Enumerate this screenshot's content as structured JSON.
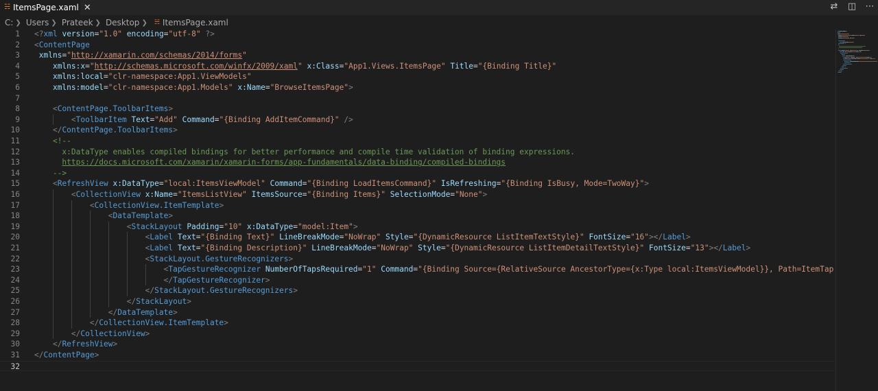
{
  "tab": {
    "label": "ItemsPage.xaml",
    "close_label": "✕"
  },
  "icons": {
    "xml": "rss-xml-icon",
    "compare": "compare-changes-icon",
    "split": "split-editor-icon",
    "more": "more-actions-icon"
  },
  "breadcrumb": [
    "C:",
    "Users",
    "Prateek",
    "Desktop",
    "ItemsPage.xaml"
  ],
  "colors": {
    "tag": "#569cd6",
    "attr": "#9cdcfe",
    "string": "#ce9178",
    "comment": "#6a9955",
    "punct": "#808080"
  },
  "lines": [
    [
      [
        "t-pi",
        "<?"
      ],
      [
        "t-tag",
        "xml"
      ],
      [
        "t-eq",
        " "
      ],
      [
        "t-attr",
        "version"
      ],
      [
        "t-eq",
        "="
      ],
      [
        "t-str",
        "\"1.0\""
      ],
      [
        "t-eq",
        " "
      ],
      [
        "t-attr",
        "encoding"
      ],
      [
        "t-eq",
        "="
      ],
      [
        "t-str",
        "\"utf-8\""
      ],
      [
        "t-eq",
        " "
      ],
      [
        "t-pi",
        "?>"
      ]
    ],
    [
      [
        "t-punct",
        "<"
      ],
      [
        "t-tag",
        "ContentPage"
      ]
    ],
    [
      [
        "t-eq",
        " "
      ],
      [
        "t-attr",
        "xmlns"
      ],
      [
        "t-eq",
        "="
      ],
      [
        "t-str",
        "\""
      ],
      [
        "t-url",
        "http://xamarin.com/schemas/2014/forms"
      ],
      [
        "t-str",
        "\""
      ]
    ],
    [
      [
        "t-eq",
        "    "
      ],
      [
        "t-attr",
        "xmlns:x"
      ],
      [
        "t-eq",
        "="
      ],
      [
        "t-str",
        "\""
      ],
      [
        "t-url",
        "http://schemas.microsoft.com/winfx/2009/xaml"
      ],
      [
        "t-str",
        "\""
      ],
      [
        "t-eq",
        " "
      ],
      [
        "t-attr",
        "x:Class"
      ],
      [
        "t-eq",
        "="
      ],
      [
        "t-str",
        "\"App1.Views.ItemsPage\""
      ],
      [
        "t-eq",
        " "
      ],
      [
        "t-attr",
        "Title"
      ],
      [
        "t-eq",
        "="
      ],
      [
        "t-str",
        "\"{Binding Title}\""
      ]
    ],
    [
      [
        "t-eq",
        "    "
      ],
      [
        "t-attr",
        "xmlns:local"
      ],
      [
        "t-eq",
        "="
      ],
      [
        "t-str",
        "\"clr-namespace:App1.ViewModels\""
      ]
    ],
    [
      [
        "t-eq",
        "    "
      ],
      [
        "t-attr",
        "xmlns:model"
      ],
      [
        "t-eq",
        "="
      ],
      [
        "t-str",
        "\"clr-namespace:App1.Models\""
      ],
      [
        "t-eq",
        " "
      ],
      [
        "t-attr",
        "x:Name"
      ],
      [
        "t-eq",
        "="
      ],
      [
        "t-str",
        "\"BrowseItemsPage\""
      ],
      [
        "t-punct",
        ">"
      ]
    ],
    [],
    [
      [
        "t-eq",
        "    "
      ],
      [
        "t-punct",
        "<"
      ],
      [
        "t-tag",
        "ContentPage.ToolbarItems"
      ],
      [
        "t-punct",
        ">"
      ]
    ],
    [
      [
        "t-eq",
        "        "
      ],
      [
        "t-punct",
        "<"
      ],
      [
        "t-tag",
        "ToolbarItem"
      ],
      [
        "t-eq",
        " "
      ],
      [
        "t-attr",
        "Text"
      ],
      [
        "t-eq",
        "="
      ],
      [
        "t-str",
        "\"Add\""
      ],
      [
        "t-eq",
        " "
      ],
      [
        "t-attr",
        "Command"
      ],
      [
        "t-eq",
        "="
      ],
      [
        "t-str",
        "\"{Binding AddItemCommand}\""
      ],
      [
        "t-eq",
        " "
      ],
      [
        "t-punct",
        "/>"
      ]
    ],
    [
      [
        "t-eq",
        "    "
      ],
      [
        "t-punct",
        "</"
      ],
      [
        "t-tag",
        "ContentPage.ToolbarItems"
      ],
      [
        "t-punct",
        ">"
      ]
    ],
    [
      [
        "t-eq",
        "    "
      ],
      [
        "t-com",
        "<!--"
      ]
    ],
    [
      [
        "t-com",
        "      x:DataType enables compiled bindings for better performance and compile time validation of binding expressions."
      ]
    ],
    [
      [
        "t-com",
        "      "
      ],
      [
        "t-comurl",
        "https://docs.microsoft.com/xamarin/xamarin-forms/app-fundamentals/data-binding/compiled-bindings"
      ]
    ],
    [
      [
        "t-com",
        "    -->"
      ]
    ],
    [
      [
        "t-eq",
        "    "
      ],
      [
        "t-punct",
        "<"
      ],
      [
        "t-tag",
        "RefreshView"
      ],
      [
        "t-eq",
        " "
      ],
      [
        "t-attr",
        "x:DataType"
      ],
      [
        "t-eq",
        "="
      ],
      [
        "t-str",
        "\"local:ItemsViewModel\""
      ],
      [
        "t-eq",
        " "
      ],
      [
        "t-attr",
        "Command"
      ],
      [
        "t-eq",
        "="
      ],
      [
        "t-str",
        "\"{Binding LoadItemsCommand}\""
      ],
      [
        "t-eq",
        " "
      ],
      [
        "t-attr",
        "IsRefreshing"
      ],
      [
        "t-eq",
        "="
      ],
      [
        "t-str",
        "\"{Binding IsBusy, Mode=TwoWay}\""
      ],
      [
        "t-punct",
        ">"
      ]
    ],
    [
      [
        "t-eq",
        "        "
      ],
      [
        "t-punct",
        "<"
      ],
      [
        "t-tag",
        "CollectionView"
      ],
      [
        "t-eq",
        " "
      ],
      [
        "t-attr",
        "x:Name"
      ],
      [
        "t-eq",
        "="
      ],
      [
        "t-str",
        "\"ItemsListView\""
      ],
      [
        "t-eq",
        " "
      ],
      [
        "t-attr",
        "ItemsSource"
      ],
      [
        "t-eq",
        "="
      ],
      [
        "t-str",
        "\"{Binding Items}\""
      ],
      [
        "t-eq",
        " "
      ],
      [
        "t-attr",
        "SelectionMode"
      ],
      [
        "t-eq",
        "="
      ],
      [
        "t-str",
        "\"None\""
      ],
      [
        "t-punct",
        ">"
      ]
    ],
    [
      [
        "t-eq",
        "            "
      ],
      [
        "t-punct",
        "<"
      ],
      [
        "t-tag",
        "CollectionView.ItemTemplate"
      ],
      [
        "t-punct",
        ">"
      ]
    ],
    [
      [
        "t-eq",
        "                "
      ],
      [
        "t-punct",
        "<"
      ],
      [
        "t-tag",
        "DataTemplate"
      ],
      [
        "t-punct",
        ">"
      ]
    ],
    [
      [
        "t-eq",
        "                    "
      ],
      [
        "t-punct",
        "<"
      ],
      [
        "t-tag",
        "StackLayout"
      ],
      [
        "t-eq",
        " "
      ],
      [
        "t-attr",
        "Padding"
      ],
      [
        "t-eq",
        "="
      ],
      [
        "t-str",
        "\"10\""
      ],
      [
        "t-eq",
        " "
      ],
      [
        "t-attr",
        "x:DataType"
      ],
      [
        "t-eq",
        "="
      ],
      [
        "t-str",
        "\"model:Item\""
      ],
      [
        "t-punct",
        ">"
      ]
    ],
    [
      [
        "t-eq",
        "                        "
      ],
      [
        "t-punct",
        "<"
      ],
      [
        "t-tag",
        "Label"
      ],
      [
        "t-eq",
        " "
      ],
      [
        "t-attr",
        "Text"
      ],
      [
        "t-eq",
        "="
      ],
      [
        "t-str",
        "\"{Binding Text}\""
      ],
      [
        "t-eq",
        " "
      ],
      [
        "t-attr",
        "LineBreakMode"
      ],
      [
        "t-eq",
        "="
      ],
      [
        "t-str",
        "\"NoWrap\""
      ],
      [
        "t-eq",
        " "
      ],
      [
        "t-attr",
        "Style"
      ],
      [
        "t-eq",
        "="
      ],
      [
        "t-str",
        "\"{DynamicResource ListItemTextStyle}\""
      ],
      [
        "t-eq",
        " "
      ],
      [
        "t-attr",
        "FontSize"
      ],
      [
        "t-eq",
        "="
      ],
      [
        "t-str",
        "\"16\""
      ],
      [
        "t-punct",
        "></"
      ],
      [
        "t-tag",
        "Label"
      ],
      [
        "t-punct",
        ">"
      ]
    ],
    [
      [
        "t-eq",
        "                        "
      ],
      [
        "t-punct",
        "<"
      ],
      [
        "t-tag",
        "Label"
      ],
      [
        "t-eq",
        " "
      ],
      [
        "t-attr",
        "Text"
      ],
      [
        "t-eq",
        "="
      ],
      [
        "t-str",
        "\"{Binding Description}\""
      ],
      [
        "t-eq",
        " "
      ],
      [
        "t-attr",
        "LineBreakMode"
      ],
      [
        "t-eq",
        "="
      ],
      [
        "t-str",
        "\"NoWrap\""
      ],
      [
        "t-eq",
        " "
      ],
      [
        "t-attr",
        "Style"
      ],
      [
        "t-eq",
        "="
      ],
      [
        "t-str",
        "\"{DynamicResource ListItemDetailTextStyle}\""
      ],
      [
        "t-eq",
        " "
      ],
      [
        "t-attr",
        "FontSize"
      ],
      [
        "t-eq",
        "="
      ],
      [
        "t-str",
        "\"13\""
      ],
      [
        "t-punct",
        "></"
      ],
      [
        "t-tag",
        "Label"
      ],
      [
        "t-punct",
        ">"
      ]
    ],
    [
      [
        "t-eq",
        "                        "
      ],
      [
        "t-punct",
        "<"
      ],
      [
        "t-tag",
        "StackLayout.GestureRecognizers"
      ],
      [
        "t-punct",
        ">"
      ]
    ],
    [
      [
        "t-eq",
        "                            "
      ],
      [
        "t-punct",
        "<"
      ],
      [
        "t-tag",
        "TapGestureRecognizer"
      ],
      [
        "t-eq",
        " "
      ],
      [
        "t-attr",
        "NumberOfTapsRequired"
      ],
      [
        "t-eq",
        "="
      ],
      [
        "t-str",
        "\"1\""
      ],
      [
        "t-eq",
        " "
      ],
      [
        "t-attr",
        "Command"
      ],
      [
        "t-eq",
        "="
      ],
      [
        "t-str",
        "\"{Binding Source={RelativeSource AncestorType={x:Type local:ItemsViewModel}}, Path=ItemTapped}\""
      ],
      [
        "t-eq",
        " "
      ],
      [
        "t-attr",
        "Comma"
      ]
    ],
    [
      [
        "t-eq",
        "                            "
      ],
      [
        "t-punct",
        "</"
      ],
      [
        "t-tag",
        "TapGestureRecognizer"
      ],
      [
        "t-punct",
        ">"
      ]
    ],
    [
      [
        "t-eq",
        "                        "
      ],
      [
        "t-punct",
        "</"
      ],
      [
        "t-tag",
        "StackLayout.GestureRecognizers"
      ],
      [
        "t-punct",
        ">"
      ]
    ],
    [
      [
        "t-eq",
        "                    "
      ],
      [
        "t-punct",
        "</"
      ],
      [
        "t-tag",
        "StackLayout"
      ],
      [
        "t-punct",
        ">"
      ]
    ],
    [
      [
        "t-eq",
        "                "
      ],
      [
        "t-punct",
        "</"
      ],
      [
        "t-tag",
        "DataTemplate"
      ],
      [
        "t-punct",
        ">"
      ]
    ],
    [
      [
        "t-eq",
        "            "
      ],
      [
        "t-punct",
        "</"
      ],
      [
        "t-tag",
        "CollectionView.ItemTemplate"
      ],
      [
        "t-punct",
        ">"
      ]
    ],
    [
      [
        "t-eq",
        "        "
      ],
      [
        "t-punct",
        "</"
      ],
      [
        "t-tag",
        "CollectionView"
      ],
      [
        "t-punct",
        ">"
      ]
    ],
    [
      [
        "t-eq",
        "    "
      ],
      [
        "t-punct",
        "</"
      ],
      [
        "t-tag",
        "RefreshView"
      ],
      [
        "t-punct",
        ">"
      ]
    ],
    [
      [
        "t-punct",
        "</"
      ],
      [
        "t-tag",
        "ContentPage"
      ],
      [
        "t-punct",
        ">"
      ]
    ],
    []
  ],
  "current_line": 32
}
